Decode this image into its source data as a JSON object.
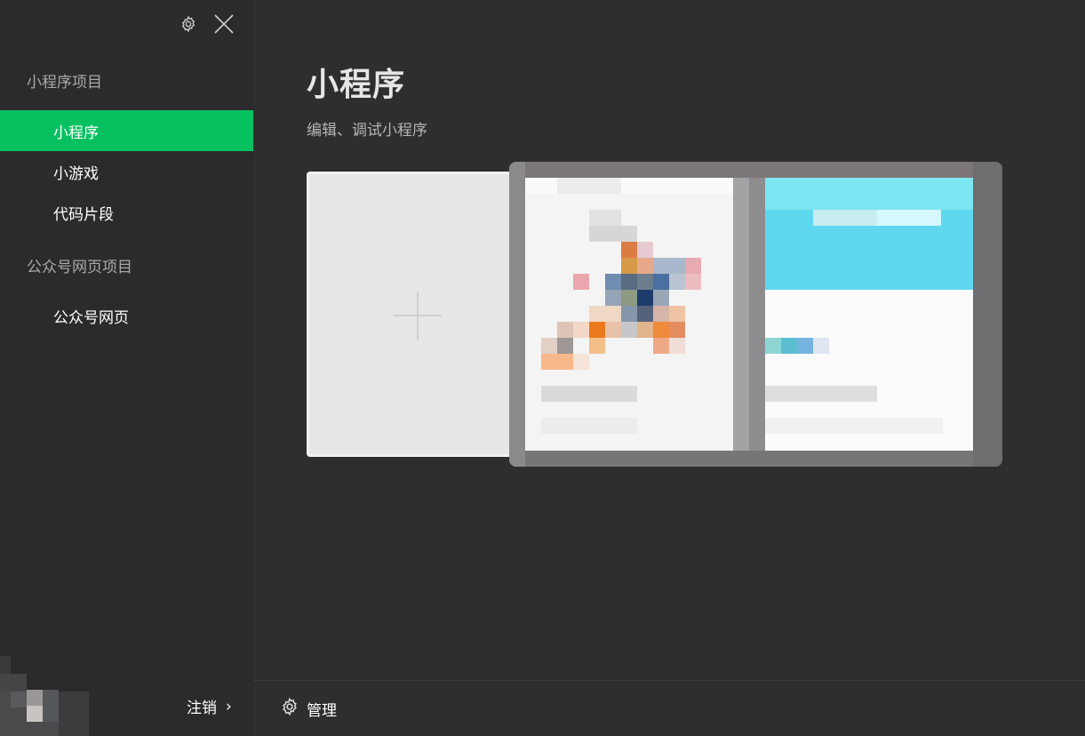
{
  "sidebar": {
    "section_miniprogram": "小程序项目",
    "items_miniprogram": [
      {
        "label": "小程序",
        "active": true
      },
      {
        "label": "小游戏",
        "active": false
      },
      {
        "label": "代码片段",
        "active": false
      }
    ],
    "section_official": "公众号网页项目",
    "items_official": [
      {
        "label": "公众号网页",
        "active": false
      }
    ],
    "logout_label": "注销",
    "logout_chevron": "›",
    "icons": {
      "settings": "gear-icon",
      "close": "close-icon"
    }
  },
  "main": {
    "title": "小程序",
    "subtitle": "编辑、调试小程序"
  },
  "footer": {
    "manage_label": "管理"
  },
  "colors": {
    "accent": "#07c160",
    "sidebar_bg": "#2b2b2d",
    "main_bg": "#2e2e30"
  }
}
